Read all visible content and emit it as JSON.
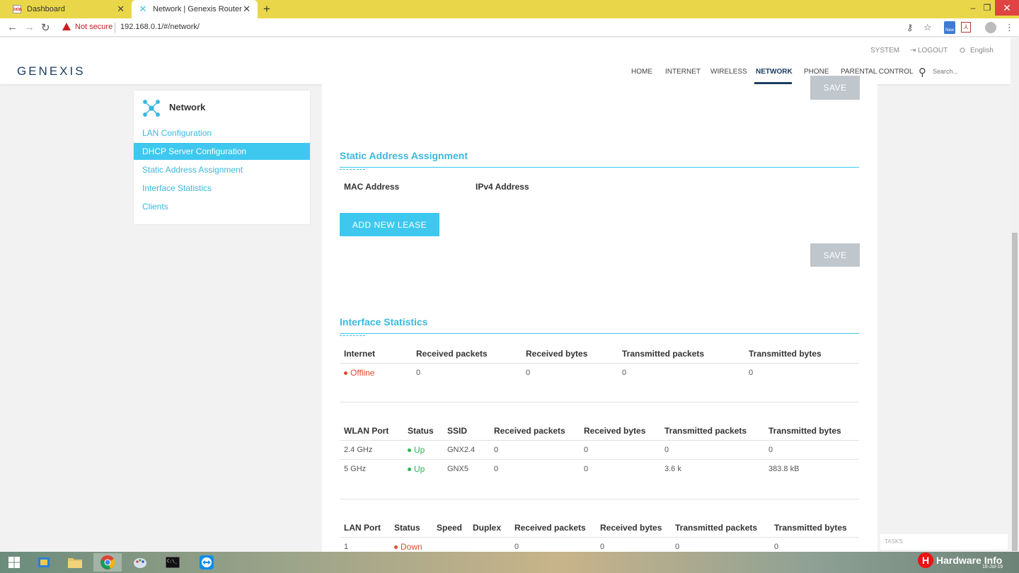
{
  "browser": {
    "tabs": [
      {
        "label": "Dashboard",
        "favicon": "ixia"
      },
      {
        "label": "Network | Genexis Router",
        "favicon": "genexis"
      }
    ],
    "not_secure": "Not secure",
    "url": "192.168.0.1/#/network/"
  },
  "header": {
    "logo": "GENEXIS",
    "util": {
      "system": "SYSTEM",
      "logout": "LOGOUT",
      "language": "English"
    },
    "nav": [
      "HOME",
      "INTERNET",
      "WIRELESS",
      "NETWORK",
      "PHONE",
      "PARENTAL CONTROL"
    ],
    "active_nav": "NETWORK",
    "search_placeholder": "Search..."
  },
  "sidebar": {
    "title": "Network",
    "items": [
      {
        "label": "LAN Configuration"
      },
      {
        "label": "DHCP Server Configuration",
        "active": true
      },
      {
        "label": "Static Address Assignment"
      },
      {
        "label": "Interface Statistics"
      },
      {
        "label": "Clients"
      }
    ]
  },
  "static": {
    "title": "Static Address Assignment",
    "col_mac": "MAC Address",
    "col_ipv4": "IPv4 Address",
    "add_button": "ADD NEW LEASE",
    "save_button": "SAVE",
    "save_top": "SAVE"
  },
  "stats": {
    "title": "Interface Statistics",
    "internet": {
      "headers": [
        "Internet",
        "Received packets",
        "Received bytes",
        "Transmitted packets",
        "Transmitted bytes"
      ],
      "rows": [
        [
          "Offline",
          "0",
          "0",
          "0",
          "0"
        ]
      ]
    },
    "wlan": {
      "headers": [
        "WLAN Port",
        "Status",
        "SSID",
        "Received packets",
        "Received bytes",
        "Transmitted packets",
        "Transmitted bytes"
      ],
      "rows": [
        [
          "2.4 GHz",
          "Up",
          "GNX2.4",
          "0",
          "0",
          "0",
          "0"
        ],
        [
          "5 GHz",
          "Up",
          "GNX5",
          "0",
          "0",
          "3.6 k",
          "383.8 kB"
        ]
      ]
    },
    "lan": {
      "headers": [
        "LAN Port",
        "Status",
        "Speed",
        "Duplex",
        "Received packets",
        "Received bytes",
        "Transmitted packets",
        "Transmitted bytes"
      ],
      "rows": [
        [
          "1",
          "Down",
          "",
          "",
          "0",
          "0",
          "0",
          "0"
        ]
      ]
    }
  },
  "overlay": {
    "tasks": "TASKS",
    "brand": "Hardware Info",
    "date": "16-Jul-19"
  },
  "colors": {
    "accent": "#3ec8ef",
    "offline": "#e24a2e",
    "up": "#2fb456",
    "brand": "#1d3e63"
  }
}
